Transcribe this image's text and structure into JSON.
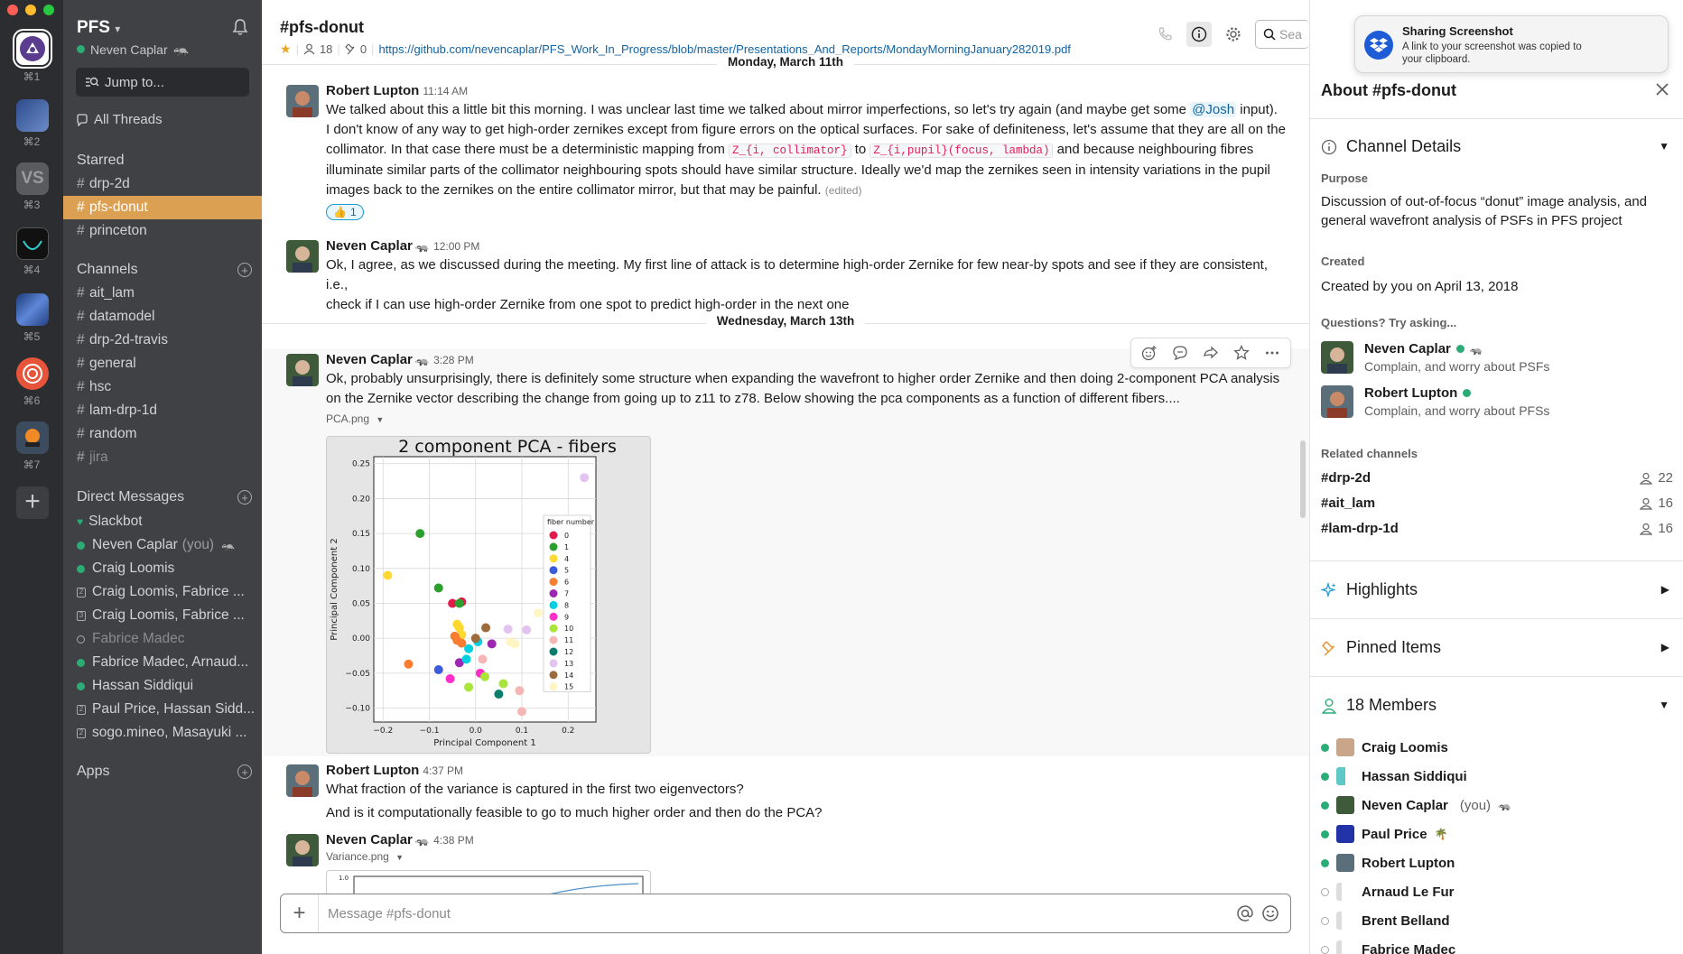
{
  "workspaces": [
    {
      "key": "⌘1"
    },
    {
      "key": "⌘2"
    },
    {
      "key": "⌘3",
      "label": "VS"
    },
    {
      "key": "⌘4"
    },
    {
      "key": "⌘5"
    },
    {
      "key": "⌘6"
    },
    {
      "key": "⌘7"
    }
  ],
  "sidebar": {
    "team_name": "PFS",
    "user_name": "Neven Caplar",
    "jump_to": "Jump to...",
    "all_threads": "All Threads",
    "starred_title": "Starred",
    "starred": [
      {
        "label": "drp-2d"
      },
      {
        "label": "pfs-donut",
        "active": true
      },
      {
        "label": "princeton"
      }
    ],
    "channels_title": "Channels",
    "channels": [
      {
        "label": "ait_lam"
      },
      {
        "label": "datamodel"
      },
      {
        "label": "drp-2d-travis"
      },
      {
        "label": "general"
      },
      {
        "label": "hsc"
      },
      {
        "label": "lam-drp-1d"
      },
      {
        "label": "random"
      },
      {
        "label": "jira"
      }
    ],
    "dm_title": "Direct Messages",
    "dms": [
      {
        "label": "Slackbot",
        "status": "heart"
      },
      {
        "label": "Neven Caplar",
        "suffix": "(you)",
        "status": "online"
      },
      {
        "label": "Craig Loomis",
        "status": "online"
      },
      {
        "label": "Craig Loomis, Fabrice ...",
        "status": "2"
      },
      {
        "label": "Craig Loomis, Fabrice ...",
        "status": "3"
      },
      {
        "label": "Fabrice Madec",
        "status": "away"
      },
      {
        "label": "Fabrice Madec, Arnaud...",
        "status": "online"
      },
      {
        "label": "Hassan Siddiqui",
        "status": "online"
      },
      {
        "label": "Paul Price, Hassan Sidd...",
        "status": "2"
      },
      {
        "label": "sogo.mineo, Masayuki ...",
        "status": "2"
      }
    ],
    "apps_title": "Apps"
  },
  "channel": {
    "title": "#pfs-donut",
    "members": "18",
    "pins": "0",
    "link": "https://github.com/nevencaplar/PFS_Work_In_Progress/blob/master/Presentations_And_Reports/MondayMorningJanuary282019.pdf",
    "search_placeholder": "Sea"
  },
  "messages": {
    "date1": "Monday, March 11th",
    "m1": {
      "author": "Robert Lupton",
      "time": "11:14 AM",
      "l1a": "We talked about this a little bit this morning.  I was unclear last time we talked about mirror imperfections, so let's try again (and maybe get some ",
      "mention": "@Josh",
      "l1b": " input).",
      "l2": "I don't know of any way to get high-order zernikes except from figure errors on the optical surfaces.   For sake of definiteness, let's assume that they are all on the",
      "l3a": "collimator.   In that case there must be a deterministic mapping from ",
      "code1": "Z_{i, collimator}",
      "l3b": " to ",
      "code2": "Z_{i,pupil}(focus, lambda)",
      "l3c": " and because neighbouring fibres",
      "l4": "illuminate similar parts of the collimator neighbouring spots should have similar structure.  Ideally we'd map the zernikes seen in intensity variations in the pupil",
      "l5": "images back to the zernikes on the entire collimator mirror, but that may be painful.",
      "edited": "(edited)",
      "reaction_count": "1"
    },
    "m2": {
      "author": "Neven Caplar",
      "time": "12:00 PM",
      "l1": "Ok, I agree, as we discussed during the meeting. My first line of attack is to determine high-order Zernike for few near-by spots and see if they are consistent, i.e.,",
      "l2": "check if I can use high-order Zernike from one spot to predict high-order in the next one"
    },
    "date2": "Wednesday, March 13th",
    "m3": {
      "author": "Neven Caplar",
      "time": "3:28 PM",
      "l1": "Ok, probably unsurprisingly, there is definitely some structure when expanding the wavefront to higher order Zernike and then doing 2-component PCA analysis",
      "l2": "on the Zernike vector describing the change from going up to z11 to z78. Below showing the pca components as a function of different fibers....",
      "file": "PCA.png"
    },
    "m4": {
      "author": "Robert Lupton",
      "time": "4:37 PM",
      "l1": "What fraction of the variance is captured in the first two eigenvectors?",
      "l2": "And is it computationally feasible to go to much higher order and then do the PCA?"
    },
    "m5": {
      "author": "Neven Caplar",
      "time": "4:38 PM",
      "file": "Variance.png",
      "peek_tick": "1.0"
    }
  },
  "composer": {
    "placeholder": "Message #pfs-donut"
  },
  "details": {
    "title": "About #pfs-donut",
    "channel_details": "Channel Details",
    "purpose_label": "Purpose",
    "purpose": "Discussion of out-of-focus “donut” image analysis, and general wavefront analysis of PSFs in PFS project",
    "created_label": "Created",
    "created": "Created by you on April 13, 2018",
    "questions_label": "Questions? Try asking...",
    "askers": [
      {
        "name": "Neven Caplar",
        "desc": "Complain, and worry about PSFs"
      },
      {
        "name": "Robert Lupton",
        "desc": "Complain, and worry about PFSs"
      }
    ],
    "related_label": "Related channels",
    "related": [
      {
        "name": "#drp-2d",
        "count": "22"
      },
      {
        "name": "#ait_lam",
        "count": "16"
      },
      {
        "name": "#lam-drp-1d",
        "count": "16"
      }
    ],
    "highlights": "Highlights",
    "pinned": "Pinned Items",
    "members_title": "18 Members",
    "members": [
      {
        "name": "Craig Loomis",
        "online": true
      },
      {
        "name": "Hassan Siddiqui",
        "online": true
      },
      {
        "name": "Neven Caplar",
        "suffix": "(you)",
        "online": true
      },
      {
        "name": "Paul Price",
        "online": true
      },
      {
        "name": "Robert Lupton",
        "online": true
      },
      {
        "name": "Arnaud Le Fur",
        "online": false
      },
      {
        "name": "Brent Belland",
        "online": false
      },
      {
        "name": "Fabrice Madec",
        "online": false
      }
    ]
  },
  "toast": {
    "title": "Sharing Screenshot",
    "body": "A link to your screenshot was copied to your clipboard."
  },
  "chart_data": {
    "type": "scatter",
    "title": "2 component PCA - fibers",
    "xlabel": "Principal Component 1",
    "ylabel": "Principal Component 2",
    "xlim": [
      -0.22,
      0.26
    ],
    "ylim": [
      -0.12,
      0.26
    ],
    "xticks": [
      "-0.2",
      "-0.1",
      "0.0",
      "0.1",
      "0.2"
    ],
    "yticks": [
      "-0.10",
      "-0.05",
      "0.00",
      "0.05",
      "0.10",
      "0.15",
      "0.20",
      "0.25"
    ],
    "legend_title": "fiber number",
    "legend_position": "right",
    "grid": true,
    "series": [
      {
        "name": "0",
        "color": "#e6194b",
        "x": [
          -0.05,
          -0.03
        ],
        "y": [
          0.05,
          0.052
        ]
      },
      {
        "name": "1",
        "color": "#2ca02c",
        "x": [
          -0.12,
          -0.08,
          -0.035
        ],
        "y": [
          0.15,
          0.072,
          0.05
        ]
      },
      {
        "name": "4",
        "color": "#ffd92f",
        "x": [
          -0.19,
          -0.04,
          -0.035,
          -0.03
        ],
        "y": [
          0.09,
          0.02,
          0.015,
          0.005
        ]
      },
      {
        "name": "5",
        "color": "#3b5bdb",
        "x": [
          -0.08
        ],
        "y": [
          -0.045
        ]
      },
      {
        "name": "6",
        "color": "#f97d31",
        "x": [
          -0.145,
          -0.045,
          -0.04,
          -0.03
        ],
        "y": [
          -0.037,
          0.003,
          -0.003,
          -0.007
        ]
      },
      {
        "name": "7",
        "color": "#9c27b0",
        "x": [
          -0.035,
          0.035
        ],
        "y": [
          -0.035,
          -0.008
        ]
      },
      {
        "name": "8",
        "color": "#00d0e0",
        "x": [
          -0.02,
          -0.015,
          0.005
        ],
        "y": [
          -0.03,
          -0.015,
          -0.005
        ]
      },
      {
        "name": "9",
        "color": "#ff2ecb",
        "x": [
          -0.055,
          0.01
        ],
        "y": [
          -0.058,
          -0.05
        ]
      },
      {
        "name": "10",
        "color": "#a8e63a",
        "x": [
          -0.015,
          0.02,
          0.06
        ],
        "y": [
          -0.07,
          -0.055,
          -0.065
        ]
      },
      {
        "name": "11",
        "color": "#f7b6b6",
        "x": [
          0.015,
          0.095,
          0.1
        ],
        "y": [
          -0.03,
          -0.075,
          -0.105
        ]
      },
      {
        "name": "12",
        "color": "#0b7d6e",
        "x": [
          0.05
        ],
        "y": [
          -0.08
        ]
      },
      {
        "name": "13",
        "color": "#e3c4f0",
        "x": [
          0.07,
          0.11,
          0.235
        ],
        "y": [
          0.013,
          0.012,
          0.23
        ]
      },
      {
        "name": "14",
        "color": "#9c6b3c",
        "x": [
          0.0,
          0.022
        ],
        "y": [
          0.0,
          0.015
        ]
      },
      {
        "name": "15",
        "color": "#fff5c4",
        "x": [
          0.075,
          0.085,
          0.135
        ],
        "y": [
          -0.005,
          -0.008,
          0.036
        ]
      }
    ]
  }
}
